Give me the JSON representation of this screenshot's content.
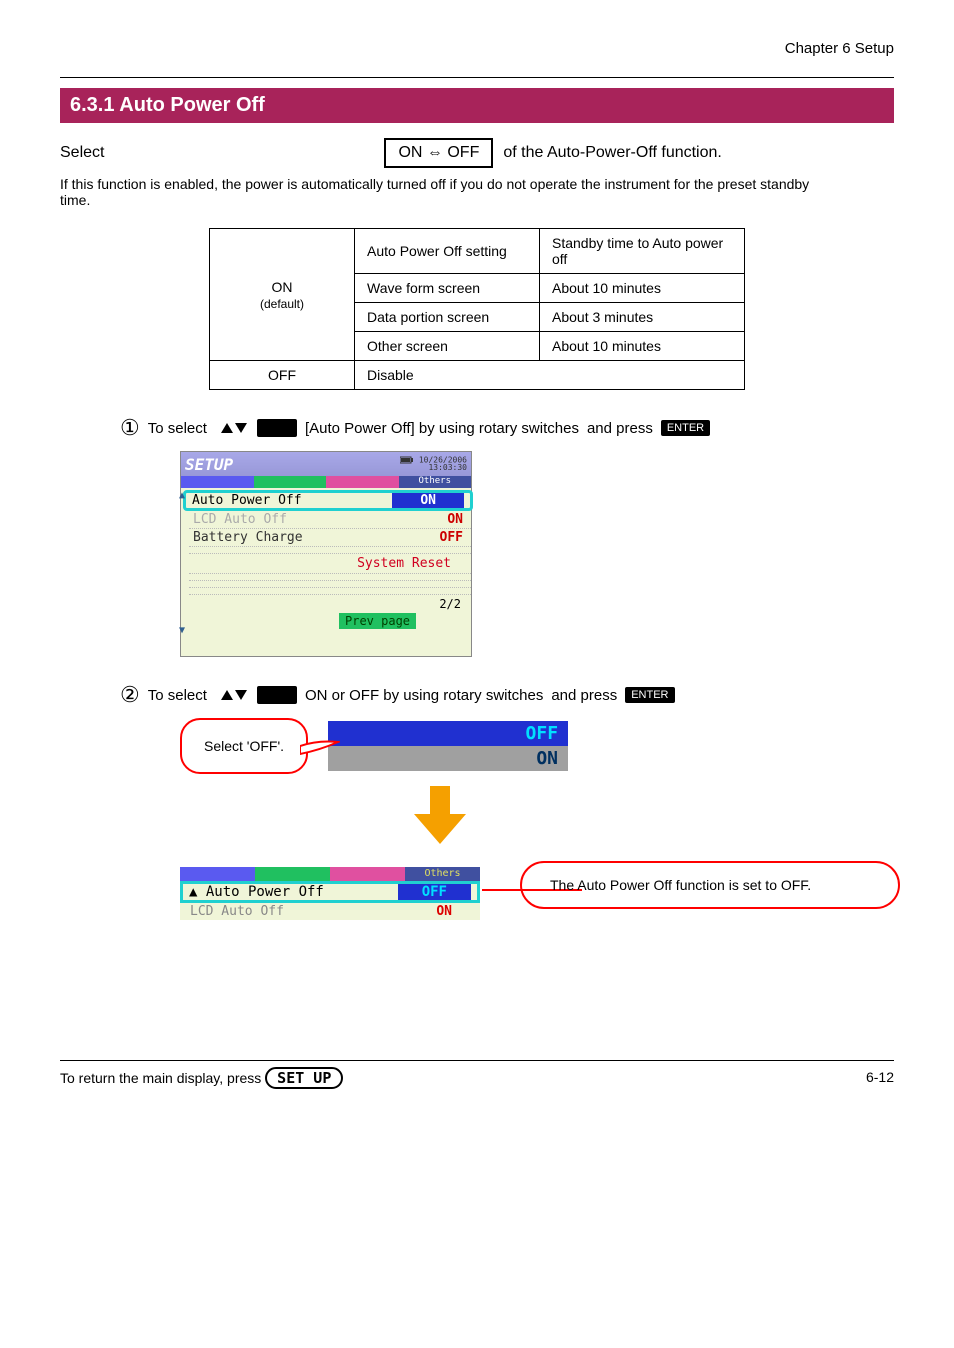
{
  "header": {
    "chapter": "Chapter 6 Setup",
    "section_title": "6.3.1 Auto Power Off",
    "intro_line_prefix": "Select",
    "intro_box_text": "ON ⇔ OFF",
    "intro_line_suffix": "of the Auto-Power-Off function.",
    "desc": "If this function is enabled, the power is automatically turned off if you do not operate the instrument for the preset standby time."
  },
  "options_table": {
    "headers": [
      "Auto Power Off setting",
      "Standby time to Auto power off"
    ],
    "rows": [
      {
        "setting": "Wave form screen",
        "time": "About 10 minutes"
      },
      {
        "setting": "Data portion screen",
        "time": "About 3 minutes"
      },
      {
        "setting": "Other screen",
        "time": "About 10 minutes"
      }
    ]
  },
  "step1": {
    "num": "①",
    "prefix": "To select",
    "icon_hint": "▲▼",
    "mid": "[Auto Power Off] by using rotary switches",
    "suffix": "and press"
  },
  "screen1": {
    "title": "SETUP",
    "date": "10/26/2006",
    "time": "13:03:30",
    "tab_label": "Others",
    "rows": {
      "r1": {
        "label": "Auto Power Off",
        "value": "ON"
      },
      "r2": {
        "label": "LCD Auto Off",
        "value": "ON"
      },
      "r3": {
        "label": "Battery Charge",
        "value": "OFF"
      }
    },
    "system_reset": "System Reset",
    "page_indicator": "2/2",
    "prev_page": "Prev page"
  },
  "step2": {
    "num": "②",
    "prefix": "To select",
    "icon_hint": "▲▼",
    "mid": "ON or OFF by using rotary switches",
    "suffix": "and press"
  },
  "speech_text": "Select 'OFF'.",
  "option_popup": {
    "selected": "OFF",
    "other": "ON"
  },
  "result": {
    "tab_label": "Others",
    "row1": {
      "label": "Auto Power Off",
      "value": "OFF"
    },
    "row2": {
      "label": "LCD Auto Off",
      "value": "ON"
    },
    "callout": "The Auto Power Off function is set to OFF."
  },
  "footer": {
    "left": "To return the main display, press",
    "page": "6-12"
  }
}
